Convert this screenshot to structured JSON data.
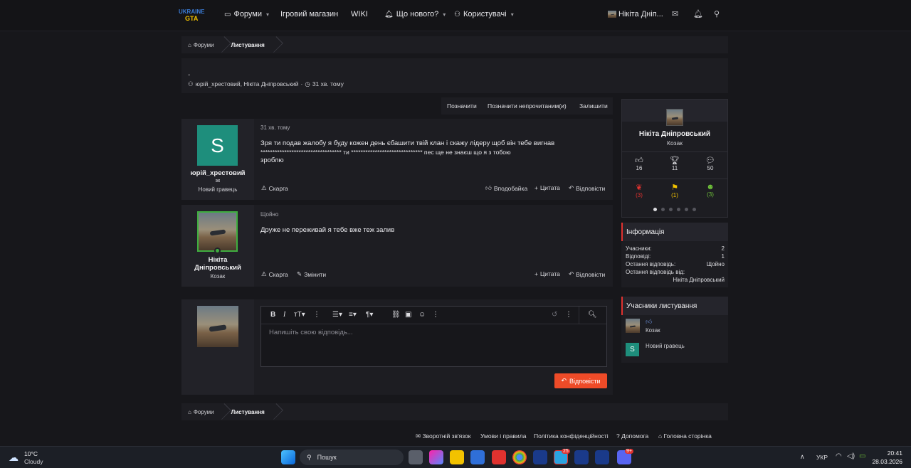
{
  "nav": {
    "forums": "Форуми",
    "shop": "Ігровий магазин",
    "wiki": "WIKI",
    "whats_new": "Що нового?",
    "users": "Користувачі",
    "account_name": "Нікіта Дніп..."
  },
  "logo": {
    "text": "UKRAINE GTA"
  },
  "breadcrumb": {
    "forums": "Форуми",
    "conversations": "Листування"
  },
  "conversation": {
    "title": ".",
    "participants": "юрій_хрестовий, Нікіта Дніпровський",
    "separator": "·",
    "time": "31 хв. тому"
  },
  "actions": {
    "mark": "Позначити",
    "mark_unread": "Позначити непрочитаним(и)",
    "leave": "Залишити"
  },
  "messages": [
    {
      "avatar_letter": "S",
      "author": "юрій_хрестовий",
      "title": "Новий гравець",
      "time": "31 хв. тому",
      "line1": "Зря ти подав жалобу я буду кожен день єбашити твій клан і скажу лідеру щоб він тебе вигнав",
      "line2": "********************************** ти ****************************** пес ще не знаєш що я з тобою",
      "line3": "зроблю",
      "report": "Скарга",
      "like": "Вподобайка",
      "quote": "Цитата",
      "reply": "Відповісти"
    },
    {
      "author_line1": "Нікіта",
      "author_line2": "Дніпровський",
      "title": "Козак",
      "time": "Щойно",
      "text": "Друже не переживай я тебе вже теж залив",
      "report": "Скарга",
      "edit": "Змінити",
      "quote": "Цитата",
      "reply": "Відповісти"
    }
  ],
  "editor": {
    "placeholder": "Напишіть свою відповідь...",
    "submit": "Відповісти"
  },
  "profile": {
    "name": "Нікіта Дніпровський",
    "title": "Козак",
    "stats": [
      "16",
      "11",
      "50"
    ],
    "badges": [
      "(3)",
      "(1)",
      "(3)"
    ]
  },
  "info": {
    "heading": "Інформація",
    "rows": [
      {
        "label": "Учасники:",
        "value": "2"
      },
      {
        "label": "Відповіді:",
        "value": "1"
      },
      {
        "label": "Остання відповідь:",
        "value": "Щойно"
      },
      {
        "label": "Остання відповідь від:",
        "value": ""
      }
    ],
    "last_by": "Нікіта Дніпровський"
  },
  "participants": {
    "heading": "Учасники листування",
    "items": [
      {
        "title": "Козак"
      },
      {
        "letter": "S",
        "title": "Новий гравець"
      }
    ]
  },
  "footer": {
    "contact": "Зворотній зв'язок",
    "rules": "Умови і правила",
    "privacy": "Політика конфіденційності",
    "help": "Допомога",
    "home": "Головна сторінка"
  },
  "taskbar": {
    "temp": "10°C",
    "weather": "Cloudy",
    "search": "Пошук",
    "lang": "УКР",
    "time": "20:41",
    "date": "28.03.2026",
    "badge1": "25",
    "badge2": "9+"
  },
  "colors": {
    "accent": "#ee4b28",
    "teal": "#1e8e7c",
    "sidebar_accent": "#e0322f"
  }
}
